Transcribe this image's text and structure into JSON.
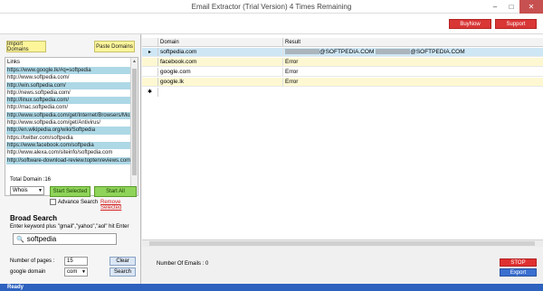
{
  "window": {
    "title": "Email Extractor  (Trial Version) 4 Times Remaining",
    "minimize": "–",
    "maximize": "□",
    "close": "✕"
  },
  "topbar": {
    "buynow": "BuyNow",
    "support": "Support"
  },
  "left": {
    "import_domains": "Import Domains",
    "paste_domains": "Paste Domains",
    "links_label": "Links",
    "links": [
      {
        "text": "https://www.google.lk/#q=softpedia",
        "selected": true
      },
      {
        "text": "http://www.softpedia.com/",
        "selected": false
      },
      {
        "text": "http://win.softpedia.com/",
        "selected": true
      },
      {
        "text": "http://news.softpedia.com/",
        "selected": false
      },
      {
        "text": "http://linux.softpedia.com/",
        "selected": true
      },
      {
        "text": "http://mac.softpedia.com/",
        "selected": false
      },
      {
        "text": "http://www.softpedia.com/get/Internet/Browsers/Moz",
        "selected": true
      },
      {
        "text": "http://www.softpedia.com/get/Antivirus/",
        "selected": false
      },
      {
        "text": "http://en.wikipedia.org/wiki/Softpedia",
        "selected": true
      },
      {
        "text": "https://twitter.com/softpedia",
        "selected": false
      },
      {
        "text": "https://www.facebook.com/softpedia",
        "selected": true
      },
      {
        "text": "http://www.alexa.com/siteinfo/softpedia.com",
        "selected": false
      },
      {
        "text": "http://software-download-review.toptenreviews.com/",
        "selected": true
      }
    ],
    "total_domain": "Total Domain :16",
    "whois_value": "Whois",
    "start_selected": "Start Selected",
    "start_all": "Start All",
    "advance_search": "Advance Search",
    "remove_selected": "Remove Selected",
    "broad_title": "Broad Search",
    "broad_hint": "Enter keyword plus \"gmail\",\"yahoo\",\"aol\" hit Enter",
    "search_value": "softpedia",
    "pages_label": "Number of pages :",
    "pages_value": "15",
    "domain_label": "google domain",
    "domain_value": "com",
    "clear": "Clear",
    "search": "Search"
  },
  "grid": {
    "col_domain": "Domain",
    "col_result": "Result",
    "rows": [
      {
        "marker": "▸",
        "domain": "softpedia.com",
        "result_a": "@SOFTPEDIA.COM ",
        "result_b": "@SOFTPEDIA.COM",
        "style": "blue"
      },
      {
        "marker": "",
        "domain": "facebook.com",
        "result": "Error",
        "style": "yellow"
      },
      {
        "marker": "",
        "domain": "google.com",
        "result": "Error",
        "style": "white"
      },
      {
        "marker": "",
        "domain": "google.lk",
        "result": "Error",
        "style": "yellow"
      },
      {
        "marker": "✱",
        "domain": "",
        "result": "",
        "style": "white"
      }
    ]
  },
  "bottom": {
    "num_emails": "Number Of Emails : 0",
    "stop": "STOP",
    "export": "Export"
  },
  "status": "Ready"
}
